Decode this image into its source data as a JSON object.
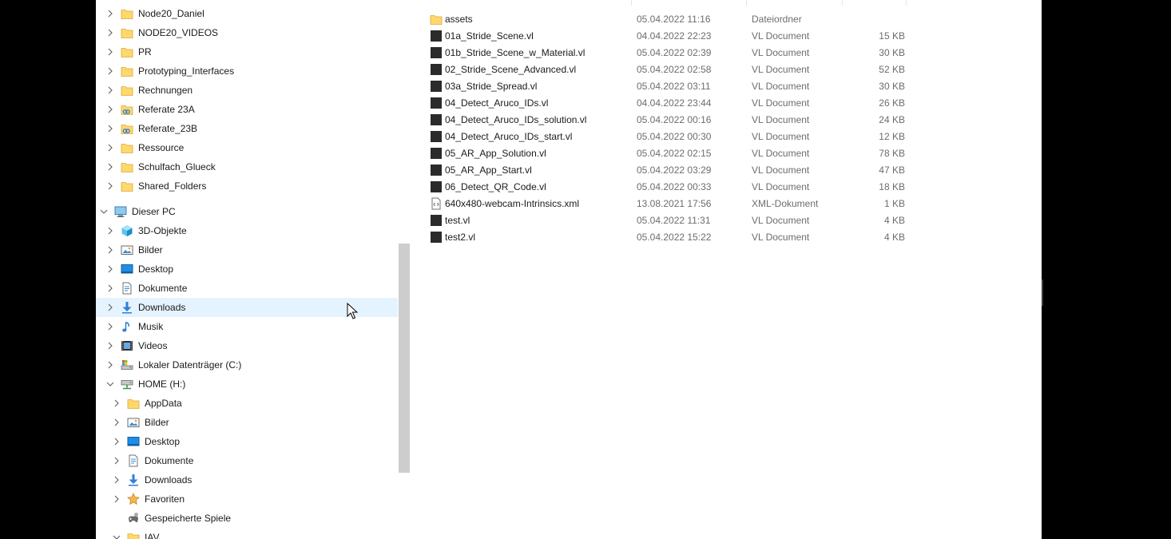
{
  "navigation": {
    "items": [
      {
        "label": "Node20_Daniel",
        "icon": "folder-icon",
        "expanded": false,
        "level": 1
      },
      {
        "label": "NODE20_VIDEOS",
        "icon": "folder-icon",
        "expanded": false,
        "level": 1
      },
      {
        "label": "PR",
        "icon": "folder-icon",
        "expanded": false,
        "level": 1
      },
      {
        "label": "Prototyping_Interfaces",
        "icon": "folder-icon",
        "expanded": false,
        "level": 1
      },
      {
        "label": "Rechnungen",
        "icon": "folder-icon",
        "expanded": false,
        "level": 1
      },
      {
        "label": "Referate 23A",
        "icon": "shared-folder-icon",
        "expanded": false,
        "level": 1
      },
      {
        "label": "Referate_23B",
        "icon": "shared-folder-icon",
        "expanded": false,
        "level": 1
      },
      {
        "label": "Ressource",
        "icon": "folder-icon",
        "expanded": false,
        "level": 1
      },
      {
        "label": "Schulfach_Glueck",
        "icon": "folder-icon",
        "expanded": false,
        "level": 1
      },
      {
        "label": "Shared_Folders",
        "icon": "folder-icon",
        "expanded": false,
        "level": 1
      },
      {
        "label": "Dieser PC",
        "icon": "computer-icon",
        "expanded": true,
        "level": 0
      },
      {
        "label": "3D-Objekte",
        "icon": "3d-objects-icon",
        "expanded": false,
        "level": 1
      },
      {
        "label": "Bilder",
        "icon": "pictures-icon",
        "expanded": false,
        "level": 1
      },
      {
        "label": "Desktop",
        "icon": "desktop-icon",
        "expanded": false,
        "level": 1
      },
      {
        "label": "Dokumente",
        "icon": "documents-icon",
        "expanded": false,
        "level": 1
      },
      {
        "label": "Downloads",
        "icon": "downloads-icon",
        "expanded": false,
        "level": 1,
        "hover": true
      },
      {
        "label": "Musik",
        "icon": "music-icon",
        "expanded": false,
        "level": 1
      },
      {
        "label": "Videos",
        "icon": "videos-icon",
        "expanded": false,
        "level": 1
      },
      {
        "label": "Lokaler Datenträger (C:)",
        "icon": "drive-icon",
        "expanded": false,
        "level": 1
      },
      {
        "label": "HOME (H:)",
        "icon": "network-drive-icon",
        "expanded": true,
        "level": 1
      },
      {
        "label": "AppData",
        "icon": "folder-icon",
        "expanded": false,
        "level": 2
      },
      {
        "label": "Bilder",
        "icon": "pictures-icon",
        "expanded": false,
        "level": 2
      },
      {
        "label": "Desktop",
        "icon": "desktop-icon",
        "expanded": false,
        "level": 2
      },
      {
        "label": "Dokumente",
        "icon": "documents-icon",
        "expanded": false,
        "level": 2
      },
      {
        "label": "Downloads",
        "icon": "downloads-icon",
        "expanded": false,
        "level": 2
      },
      {
        "label": "Favoriten",
        "icon": "star-icon",
        "expanded": false,
        "level": 2
      },
      {
        "label": "Gespeicherte Spiele",
        "icon": "saved-games-icon",
        "expanded": null,
        "level": 2
      },
      {
        "label": "IAV",
        "icon": "folder-icon",
        "expanded": true,
        "level": 2
      }
    ]
  },
  "files": [
    {
      "name": "assets",
      "date": "05.04.2022 11:16",
      "type": "Dateiordner",
      "size": "",
      "icon": "folder-icon"
    },
    {
      "name": "01a_Stride_Scene.vl",
      "date": "04.04.2022 22:23",
      "type": "VL Document",
      "size": "15 KB",
      "icon": "vl-file-icon"
    },
    {
      "name": "01b_Stride_Scene_w_Material.vl",
      "date": "05.04.2022 02:39",
      "type": "VL Document",
      "size": "30 KB",
      "icon": "vl-file-icon"
    },
    {
      "name": "02_Stride_Scene_Advanced.vl",
      "date": "05.04.2022 02:58",
      "type": "VL Document",
      "size": "52 KB",
      "icon": "vl-file-icon"
    },
    {
      "name": "03a_Stride_Spread.vl",
      "date": "05.04.2022 03:11",
      "type": "VL Document",
      "size": "30 KB",
      "icon": "vl-file-icon"
    },
    {
      "name": "04_Detect_Aruco_IDs.vl",
      "date": "04.04.2022 23:44",
      "type": "VL Document",
      "size": "26 KB",
      "icon": "vl-file-icon"
    },
    {
      "name": "04_Detect_Aruco_IDs_solution.vl",
      "date": "05.04.2022 00:16",
      "type": "VL Document",
      "size": "24 KB",
      "icon": "vl-file-icon"
    },
    {
      "name": "04_Detect_Aruco_IDs_start.vl",
      "date": "05.04.2022 00:30",
      "type": "VL Document",
      "size": "12 KB",
      "icon": "vl-file-icon"
    },
    {
      "name": "05_AR_App_Solution.vl",
      "date": "05.04.2022 02:15",
      "type": "VL Document",
      "size": "78 KB",
      "icon": "vl-file-icon"
    },
    {
      "name": "05_AR_App_Start.vl",
      "date": "05.04.2022 03:29",
      "type": "VL Document",
      "size": "47 KB",
      "icon": "vl-file-icon"
    },
    {
      "name": "06_Detect_QR_Code.vl",
      "date": "05.04.2022 00:33",
      "type": "VL Document",
      "size": "18 KB",
      "icon": "vl-file-icon"
    },
    {
      "name": "640x480-webcam-Intrinsics.xml",
      "date": "13.08.2021 17:56",
      "type": "XML-Dokument",
      "size": "1 KB",
      "icon": "xml-file-icon"
    },
    {
      "name": "test.vl",
      "date": "05.04.2022 11:31",
      "type": "VL Document",
      "size": "4 KB",
      "icon": "vl-file-icon"
    },
    {
      "name": "test2.vl",
      "date": "05.04.2022 15:22",
      "type": "VL Document",
      "size": "4 KB",
      "icon": "vl-file-icon"
    }
  ],
  "colors": {
    "hover": "#e5f3ff",
    "folder": "#ffd86b",
    "accent": "#2f7fd8",
    "vl_file": "#2b2b2b"
  }
}
